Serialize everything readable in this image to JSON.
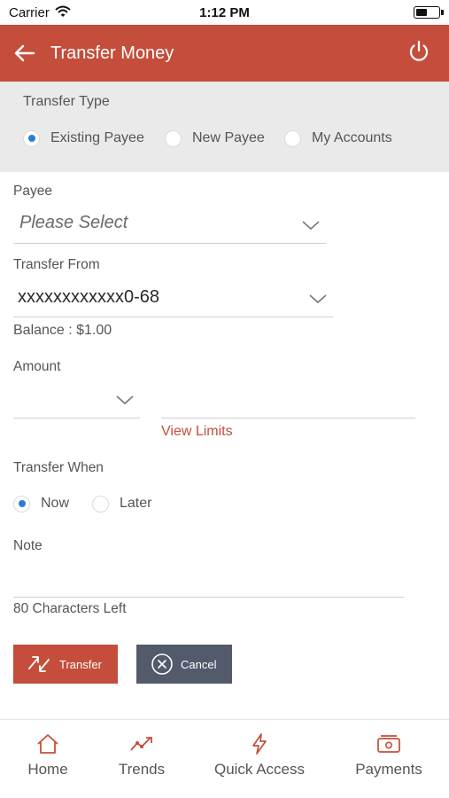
{
  "status_bar": {
    "carrier": "Carrier",
    "time": "1:12 PM"
  },
  "header": {
    "title": "Transfer Money"
  },
  "transfer_type": {
    "label": "Transfer Type",
    "options": [
      {
        "label": "Existing Payee",
        "selected": true
      },
      {
        "label": "New Payee",
        "selected": false
      },
      {
        "label": "My Accounts",
        "selected": false
      }
    ]
  },
  "payee": {
    "label": "Payee",
    "placeholder": "Please Select"
  },
  "transfer_from": {
    "label": "Transfer From",
    "value": "xxxxxxxxxxxx0-68",
    "balance": "Balance : $1.00"
  },
  "amount": {
    "label": "Amount",
    "currency_value": "",
    "value": "",
    "view_limits": "View Limits"
  },
  "transfer_when": {
    "label": "Transfer When",
    "options": [
      {
        "label": "Now",
        "selected": true
      },
      {
        "label": "Later",
        "selected": false
      }
    ]
  },
  "note": {
    "label": "Note",
    "value": "",
    "chars_left": "80 Characters Left"
  },
  "actions": {
    "transfer": "Transfer",
    "cancel": "Cancel"
  },
  "tabs": [
    {
      "label": "Home",
      "icon": "home-icon"
    },
    {
      "label": "Trends",
      "icon": "trends-icon"
    },
    {
      "label": "Quick Access",
      "icon": "lightning-icon"
    },
    {
      "label": "Payments",
      "icon": "payments-icon"
    }
  ],
  "colors": {
    "accent": "#c44e3b",
    "radio_selected": "#2c7bd6",
    "cancel_button": "#525a6b",
    "panel_bg": "#eaeaea"
  }
}
